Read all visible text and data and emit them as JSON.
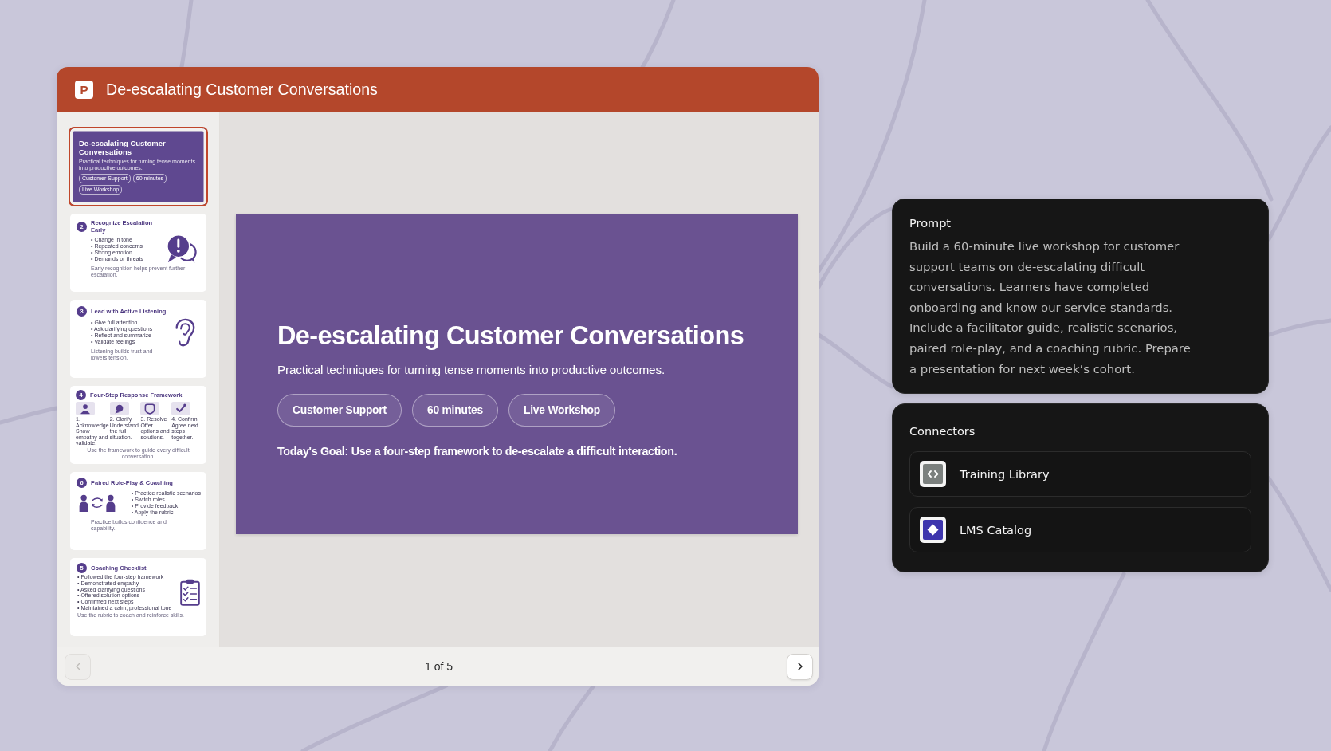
{
  "window": {
    "logo_letter": "P",
    "title": "De-escalating Customer Conversations"
  },
  "thumbnails": [
    {
      "kind": "title",
      "selected": true,
      "title": "De-escalating Customer Conversations",
      "subtitle": "Practical techniques for turning tense moments into productive outcomes.",
      "tags": [
        "Customer Support",
        "60 minutes",
        "Live Workshop"
      ]
    },
    {
      "kind": "alert",
      "selected": false,
      "number": "2",
      "title": "Recognize Escalation Early",
      "bullets": [
        "• Change in tone",
        "• Repeated concerns",
        "• Strong emotion",
        "• Demands or threats"
      ],
      "footer": "Early recognition helps prevent further escalation."
    },
    {
      "kind": "listening",
      "selected": false,
      "number": "3",
      "title": "Lead with Active Listening",
      "bullets": [
        "• Give full attention",
        "• Ask clarifying questions",
        "• Reflect and summarize",
        "• Validate feelings"
      ],
      "footer": "Listening builds trust and lowers tension."
    },
    {
      "kind": "steps",
      "selected": false,
      "number": "4",
      "title": "Four-Step Response Framework",
      "steps": [
        {
          "name": "1. Acknowledge",
          "text": "Show empathy and validate."
        },
        {
          "name": "2. Clarify",
          "text": "Understand the full situation."
        },
        {
          "name": "3. Resolve",
          "text": "Offer options and solutions."
        },
        {
          "name": "4. Confirm",
          "text": "Agree next steps together."
        }
      ],
      "footer": "Use the framework to guide every difficult conversation."
    },
    {
      "kind": "pairs",
      "selected": false,
      "number": "6",
      "title": "Paired Role-Play & Coaching",
      "bullets": [
        "• Practice realistic scenarios",
        "• Switch roles",
        "• Provide feedback",
        "• Apply the rubric"
      ],
      "footer": "Practice builds confidence and capability."
    },
    {
      "kind": "checklist",
      "selected": false,
      "number": "5",
      "title": "Coaching Checklist",
      "bullets": [
        "• Followed the four-step framework",
        "• Demonstrated empathy",
        "• Asked clarifying questions",
        "• Offered solution options",
        "• Confirmed next steps",
        "• Maintained a calm, professional tone"
      ],
      "footer": "Use the rubric to coach and reinforce skills."
    }
  ],
  "slide": {
    "title": "De-escalating Customer Conversations",
    "subtitle": "Practical techniques for turning tense moments into productive outcomes.",
    "tags": [
      "Customer Support",
      "60 minutes",
      "Live Workshop"
    ],
    "goal": "Today's Goal: Use a four-step framework to de-escalate a difficult interaction."
  },
  "pager": {
    "previous": {
      "disabled": true
    },
    "label": "1 of 5",
    "next": {
      "disabled": false
    }
  },
  "prompt": {
    "label": "Prompt",
    "text": "Build a 60-minute live workshop for customer support teams on de-escalating difficult conversations. Learners have completed onboarding and know our service standards. Include a facilitator guide, realistic scenarios, paired role-play, and a coaching rubric. Prepare a presentation for next week’s cohort."
  },
  "connectors": {
    "label": "Connectors",
    "items": [
      {
        "kind": "code",
        "name": "Training Library"
      },
      {
        "kind": "catalog",
        "name": "LMS Catalog"
      }
    ]
  }
}
